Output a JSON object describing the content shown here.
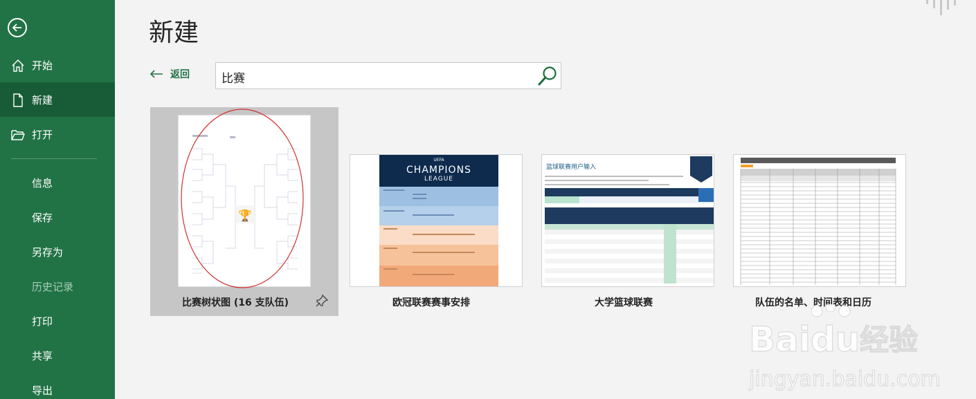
{
  "page": {
    "title": "新建"
  },
  "sidebar": {
    "items": [
      {
        "label": "开始"
      },
      {
        "label": "新建"
      },
      {
        "label": "打开"
      },
      {
        "label": "信息"
      },
      {
        "label": "保存"
      },
      {
        "label": "另存为"
      },
      {
        "label": "历史记录"
      },
      {
        "label": "打印"
      },
      {
        "label": "共享"
      },
      {
        "label": "导出"
      }
    ]
  },
  "back_link": {
    "label": "返回"
  },
  "search": {
    "value": "比赛"
  },
  "templates": [
    {
      "label": "比赛树状图 (16 支队伍)"
    },
    {
      "label": "欧冠联赛赛事安排",
      "thumb_line1": "CHAMPIONS",
      "thumb_line2": "LEAGUE",
      "thumb_badge": "UEFA"
    },
    {
      "label": "大学篮球联赛",
      "thumb_heading": "篮球联赛用户输入"
    },
    {
      "label": "队伍的名单、时间表和日历"
    }
  ],
  "watermark": {
    "brand": "Baidu",
    "product": "经验",
    "url": "jingyan.baidu.com"
  },
  "colors": {
    "sidebar": "#217346",
    "sidebar_active": "#185c37",
    "accent": "#217346"
  }
}
